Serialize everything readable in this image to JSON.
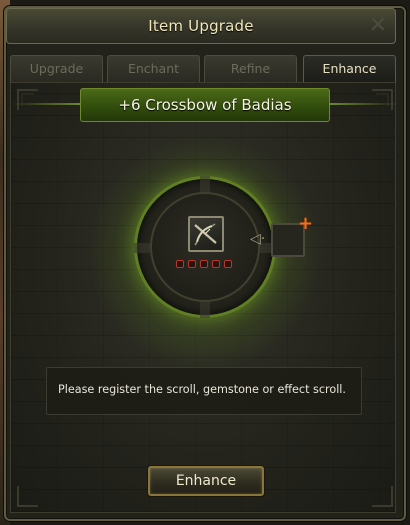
{
  "window": {
    "title": "Item Upgrade",
    "close_icon": "close-x-icon"
  },
  "tabs": [
    {
      "label": "Upgrade",
      "active": false
    },
    {
      "label": "Enchant",
      "active": false
    },
    {
      "label": "Refine",
      "active": false
    },
    {
      "label": "Enhance",
      "active": true
    }
  ],
  "item": {
    "name": "+6 Crossbow of Badias",
    "icon": "crossbow-icon",
    "slots": [
      {
        "filled": false
      },
      {
        "filled": false
      },
      {
        "filled": false
      },
      {
        "filled": false
      },
      {
        "filled": false
      }
    ]
  },
  "scroll_slot": {
    "icon": "plus-icon",
    "arrow_icon": "arrow-left-icon"
  },
  "message": "Please register the scroll, gemstone or effect scroll.",
  "buttons": {
    "enhance_label": "Enhance"
  },
  "colors": {
    "accent_green": "#5f7f22",
    "plus_orange": "#ff6a12",
    "slot_red": "#b8352a",
    "title_text": "#f0e8b8"
  }
}
